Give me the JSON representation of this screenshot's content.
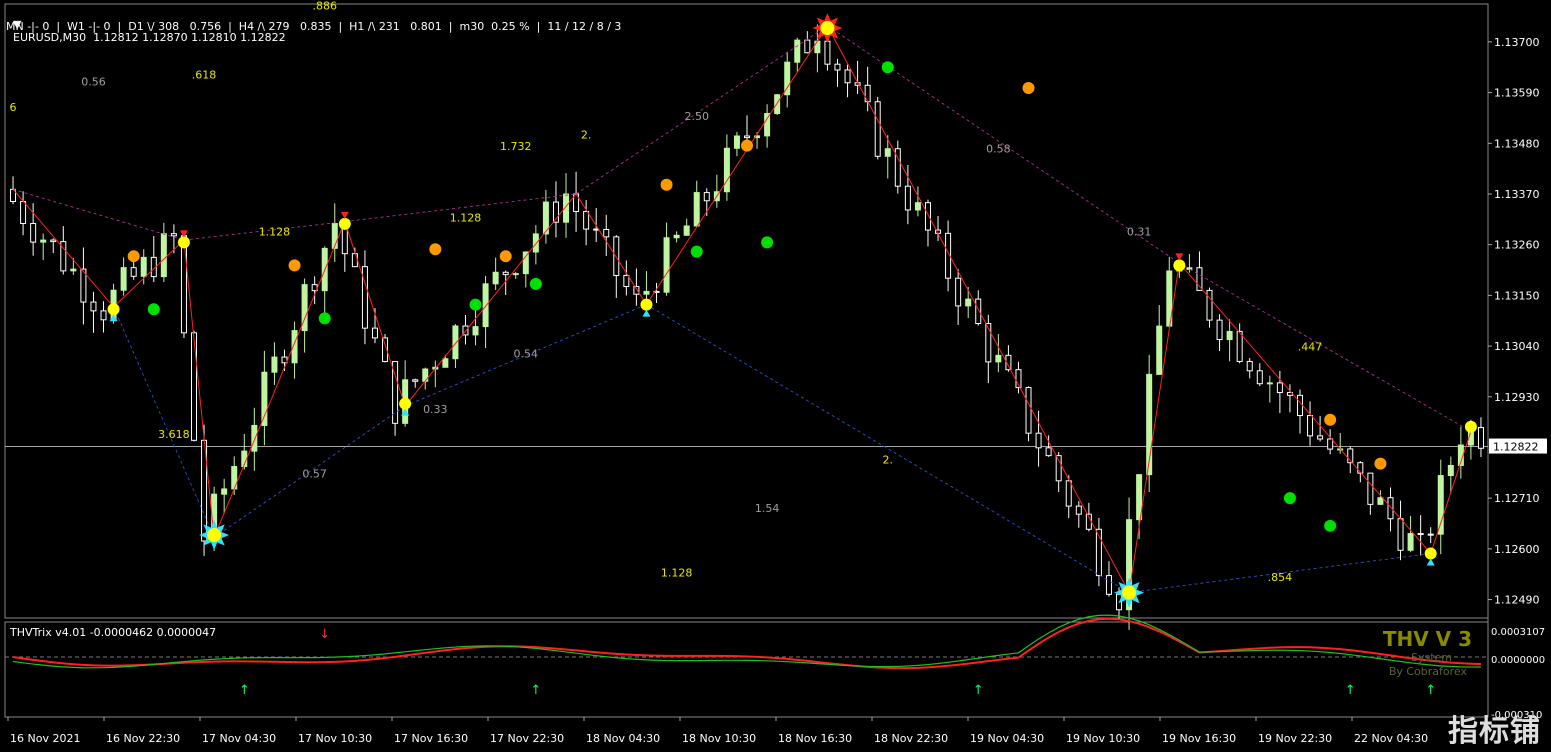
{
  "header": {
    "symbol_line": "EURUSD,M30  1.12812 1.12870 1.12810 1.12822",
    "tf_line": "MN -|- 0  |  W1 -|- 0  |  D1 \\/ 308   0.756  |  H4 /\\ 279   0.835  |  H1 /\\ 231   0.801  |  m30  0.25 %  |  11 / 12 / 8 / 3"
  },
  "watermark": "指标铺",
  "colors": {
    "background": "#000000",
    "grid": "#ffffff",
    "bull_candle": "#bff5a0",
    "bear_candle": "#ffffff",
    "zigzag": "#ff2020",
    "fib_dash": "#b03090",
    "fib_blue": "#3050d0",
    "label_yellow": "#e8e800",
    "label_gray": "#a0a0a0",
    "dot_orange": "#ff9900",
    "dot_green": "#00e000",
    "dot_yellow": "#ffff00",
    "trix_red": "#ff2020",
    "trix_green": "#20c020"
  },
  "chart_data": {
    "type": "candlestick",
    "symbol": "EURUSD",
    "timeframe": "M30",
    "ohlc_current": {
      "open": 1.12812,
      "high": 1.1287,
      "low": 1.1281,
      "close": 1.12822
    },
    "y_ticks": [
      1.137,
      1.1359,
      1.1348,
      1.1337,
      1.1326,
      1.1315,
      1.1304,
      1.1293,
      1.1271,
      1.126,
      1.1249
    ],
    "y_range": [
      1.1245,
      1.1378
    ],
    "current_price_label": "1.12822",
    "x_ticks": [
      "16 Nov 2021",
      "16 Nov 22:30",
      "17 Nov 04:30",
      "17 Nov 10:30",
      "17 Nov 16:30",
      "17 Nov 22:30",
      "18 Nov 04:30",
      "18 Nov 10:30",
      "18 Nov 16:30",
      "18 Nov 22:30",
      "19 Nov 04:30",
      "19 Nov 10:30",
      "19 Nov 16:30",
      "19 Nov 22:30",
      "22 Nov 04:30"
    ],
    "bars": 147,
    "zigzag_points": [
      {
        "bar": 0,
        "price": 1.1338
      },
      {
        "bar": 10,
        "price": 1.13125
      },
      {
        "bar": 17,
        "price": 1.1327
      },
      {
        "bar": 20,
        "price": 1.12625
      },
      {
        "bar": 33,
        "price": 1.1331
      },
      {
        "bar": 39,
        "price": 1.1291
      },
      {
        "bar": 56,
        "price": 1.1337
      },
      {
        "bar": 63,
        "price": 1.1313
      },
      {
        "bar": 81,
        "price": 1.13735
      },
      {
        "bar": 111,
        "price": 1.12505
      },
      {
        "bar": 116,
        "price": 1.1322
      },
      {
        "bar": 141,
        "price": 1.1259
      },
      {
        "bar": 145,
        "price": 1.12855
      }
    ],
    "fib_labels": [
      {
        "text": ".886",
        "bar": 31,
        "price": 1.1377,
        "color": "yellow"
      },
      {
        "text": ".618",
        "bar": 19,
        "price": 1.1362,
        "color": "yellow"
      },
      {
        "text": "0.56",
        "bar": 8,
        "price": 1.13605,
        "color": "gray"
      },
      {
        "text": "2.",
        "bar": 57,
        "price": 1.1349,
        "color": "yellow"
      },
      {
        "text": "1.732",
        "bar": 50,
        "price": 1.13465,
        "color": "yellow"
      },
      {
        "text": "2.50",
        "bar": 68,
        "price": 1.1353,
        "color": "gray"
      },
      {
        "text": "1.128",
        "bar": 45,
        "price": 1.1331,
        "color": "yellow"
      },
      {
        "text": "1.128",
        "bar": 26,
        "price": 1.1328,
        "color": "yellow"
      },
      {
        "text": "0.58",
        "bar": 98,
        "price": 1.1346,
        "color": "gray"
      },
      {
        "text": "0.31",
        "bar": 112,
        "price": 1.1328,
        "color": "gray"
      },
      {
        "text": ".447",
        "bar": 129,
        "price": 1.1303,
        "color": "yellow"
      },
      {
        "text": "0.54",
        "bar": 51,
        "price": 1.13015,
        "color": "gray"
      },
      {
        "text": "0.33",
        "bar": 42,
        "price": 1.12895,
        "color": "gray"
      },
      {
        "text": "3.618",
        "bar": 16,
        "price": 1.1284,
        "color": "yellow"
      },
      {
        "text": "2.",
        "bar": 87,
        "price": 1.12785,
        "color": "yellow"
      },
      {
        "text": "0.57",
        "bar": 30,
        "price": 1.12755,
        "color": "gray"
      },
      {
        "text": "1.54",
        "bar": 75,
        "price": 1.1268,
        "color": "gray"
      },
      {
        "text": "1.128",
        "bar": 66,
        "price": 1.1254,
        "color": "yellow"
      },
      {
        "text": ".854",
        "bar": 126,
        "price": 1.1253,
        "color": "yellow"
      },
      {
        "text": "6",
        "bar": 0,
        "price": 1.1355,
        "color": "yellow"
      }
    ],
    "dots": [
      {
        "bar": 12,
        "price": 1.13235,
        "color": "orange"
      },
      {
        "bar": 14,
        "price": 1.1312,
        "color": "green"
      },
      {
        "bar": 28,
        "price": 1.13215,
        "color": "orange"
      },
      {
        "bar": 31,
        "price": 1.131,
        "color": "green"
      },
      {
        "bar": 42,
        "price": 1.1325,
        "color": "orange"
      },
      {
        "bar": 46,
        "price": 1.1313,
        "color": "green"
      },
      {
        "bar": 49,
        "price": 1.13235,
        "color": "orange"
      },
      {
        "bar": 52,
        "price": 1.13175,
        "color": "green"
      },
      {
        "bar": 65,
        "price": 1.1339,
        "color": "orange"
      },
      {
        "bar": 68,
        "price": 1.13245,
        "color": "green"
      },
      {
        "bar": 73,
        "price": 1.13475,
        "color": "orange"
      },
      {
        "bar": 75,
        "price": 1.13265,
        "color": "green"
      },
      {
        "bar": 87,
        "price": 1.13645,
        "color": "green"
      },
      {
        "bar": 101,
        "price": 1.136,
        "color": "orange"
      },
      {
        "bar": 127,
        "price": 1.1271,
        "color": "green"
      },
      {
        "bar": 131,
        "price": 1.1265,
        "color": "green"
      },
      {
        "bar": 131,
        "price": 1.1288,
        "color": "orange"
      },
      {
        "bar": 136,
        "price": 1.12785,
        "color": "orange"
      },
      {
        "bar": 145,
        "price": 1.12865,
        "color": "yellow"
      }
    ],
    "tops": [
      {
        "bar": 17,
        "price": 1.13265
      },
      {
        "bar": 33,
        "price": 1.13305
      },
      {
        "bar": 116,
        "price": 1.13215
      }
    ],
    "bottoms": [
      {
        "bar": 10,
        "price": 1.1312
      },
      {
        "bar": 39,
        "price": 1.12915
      },
      {
        "bar": 63,
        "price": 1.1313
      },
      {
        "bar": 141,
        "price": 1.1259
      }
    ],
    "stars": [
      {
        "bar": 81,
        "price": 1.1373,
        "kind": "top"
      },
      {
        "bar": 20,
        "price": 1.1263,
        "kind": "bottom"
      },
      {
        "bar": 111,
        "price": 1.12505,
        "kind": "bottom"
      }
    ],
    "subwindow": {
      "title": "THVTrix v4.01 -0.0000462 0.0000047",
      "y_ticks": [
        "0.0003107",
        "0.0000000",
        "-0.000310"
      ],
      "branding": [
        "THV V 3",
        "System",
        "By Cobraforex"
      ],
      "up_arrows": [
        23,
        52,
        96,
        133,
        141
      ],
      "down_arrows": [
        31
      ]
    }
  }
}
